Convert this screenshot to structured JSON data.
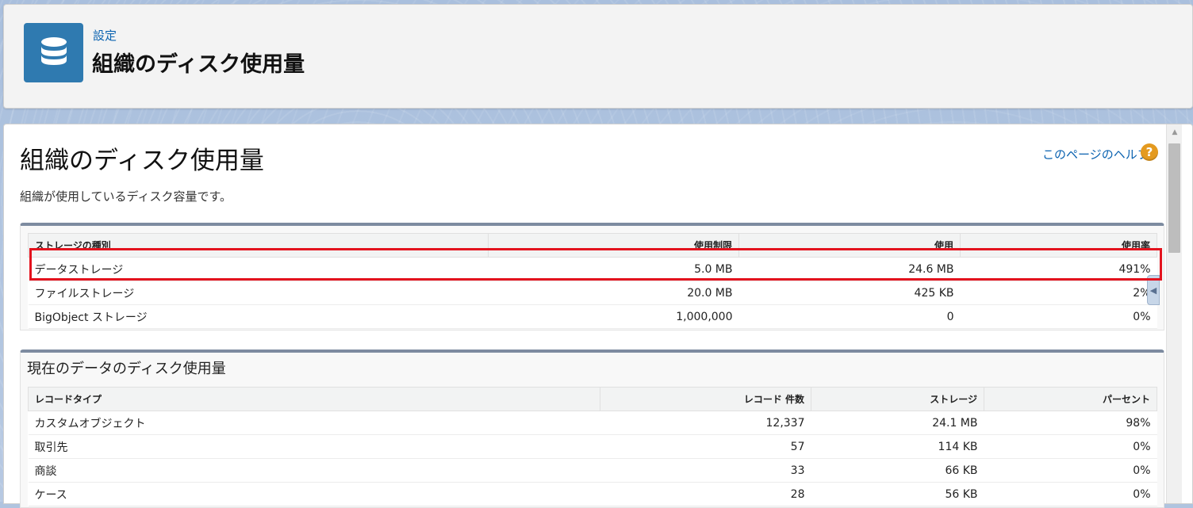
{
  "header": {
    "breadcrumb": "設定",
    "title": "組織のディスク使用量",
    "icon": "database-icon",
    "icon_color": "#2f7ab0"
  },
  "page": {
    "title": "組織のディスク使用量",
    "description": "組織が使用しているディスク容量です。",
    "help_link": "このページのヘルプ",
    "help_icon": "question-icon"
  },
  "storage_table": {
    "headers": [
      "ストレージの種別",
      "使用制限",
      "使用",
      "使用率"
    ],
    "rows": [
      {
        "type": "データストレージ",
        "limit": "5.0 MB",
        "used": "24.6 MB",
        "percent": "491%"
      },
      {
        "type": "ファイルストレージ",
        "limit": "20.0 MB",
        "used": "425 KB",
        "percent": "2%"
      },
      {
        "type": "BigObject ストレージ",
        "limit": "1,000,000",
        "used": "0",
        "percent": "0%"
      }
    ]
  },
  "data_usage": {
    "title": "現在のデータのディスク使用量",
    "headers": [
      "レコードタイプ",
      "レコード 件数",
      "ストレージ",
      "パーセント"
    ],
    "rows": [
      {
        "type": "カスタムオブジェクト",
        "count": "12,337",
        "storage": "24.1 MB",
        "percent": "98%"
      },
      {
        "type": "取引先",
        "count": "57",
        "storage": "114 KB",
        "percent": "0%"
      },
      {
        "type": "商談",
        "count": "33",
        "storage": "66 KB",
        "percent": "0%"
      },
      {
        "type": "ケース",
        "count": "28",
        "storage": "56 KB",
        "percent": "0%"
      }
    ]
  },
  "colors": {
    "highlight": "#e3131e",
    "link": "#0a62b0",
    "panel_border": "#7d8ba0"
  }
}
